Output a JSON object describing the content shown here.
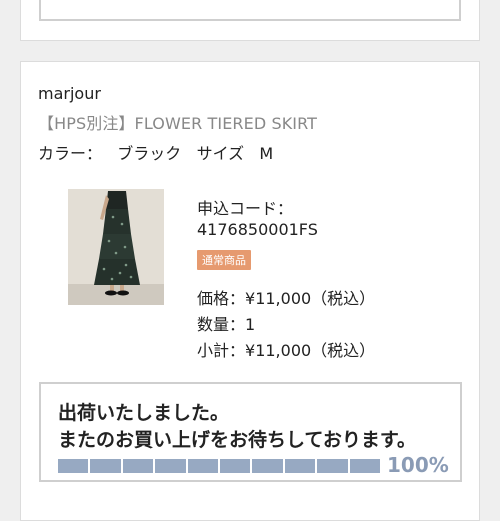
{
  "order": {
    "brand": "marjour",
    "product_name": "【HPS別注】FLOWER TIERED SKIRT",
    "color_label": "カラー：",
    "color_value": "ブラック",
    "size_label": "サイズ",
    "size_value": "M",
    "code_label": "申込コード：",
    "code_value": "4176850001FS",
    "badge": "通常商品",
    "price_label": "価格：",
    "price_value": "¥11,000（税込）",
    "quantity_label": "数量：",
    "quantity_value": "1",
    "subtotal_label": "小計：",
    "subtotal_value": "¥11,000（税込）"
  },
  "status": {
    "line1": "出荷いたしました。",
    "line2": "またのお買い上げをお待ちしております。",
    "progress_percent": 100,
    "progress_label": "100%",
    "segments_total": 10,
    "bar_color": "#97a9c2",
    "text_color": "#8a9bb5"
  },
  "colors": {
    "badge_bg": "#e69a6f",
    "product_name_text": "#888888"
  }
}
